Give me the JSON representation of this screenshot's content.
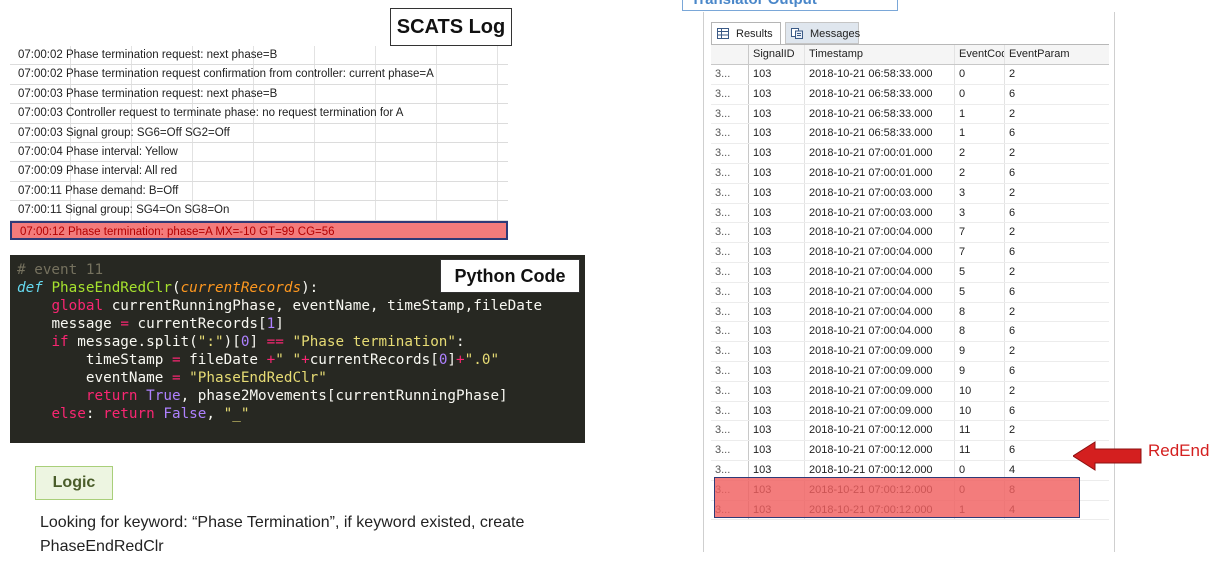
{
  "scats": {
    "title": "SCATS Log",
    "rows": [
      "07:00:02 Phase termination request: next phase=B",
      "07:00:02 Phase termination request confirmation from controller: current phase=A",
      "07:00:03 Phase termination request: next phase=B",
      "07:00:03 Controller request to terminate phase: no request termination for A",
      "07:00:03 Signal group: SG6=Off SG2=Off",
      "07:00:04 Phase interval: Yellow",
      "07:00:09 Phase interval: All red",
      "07:00:11 Phase demand: B=Off",
      "07:00:11 Signal group: SG4=On SG8=On",
      "07:00:12 Phase termination: phase=A MX=-10 GT=99 CG=56"
    ]
  },
  "python": {
    "title": "Python Code",
    "comment": "# event 11",
    "def_kw": "def",
    "func_name": "PhaseEndRedClr",
    "param": "currentRecords",
    "global_kw": "global",
    "global_vars": " currentRunningPhase, eventName, timeStamp,fileDate",
    "message_assign": "message ",
    "message_rhs": " currentRecords[",
    "idx1": "1",
    "if_kw": "if",
    "split_a": " message.split(",
    "colon_str": "\":\"",
    "split_b": ")[",
    "idx0": "0",
    "split_c": "] ",
    "phase_str": "\"Phase termination\"",
    "ts_a": "timeStamp ",
    "ts_b": " fileDate ",
    "space_str": "\" \"",
    "ts_c": "currentRecords[",
    "ts_d": "]",
    "dot0_str": "\".0\"",
    "ev_a": "eventName ",
    "ev_str": "\"PhaseEndRedClr\"",
    "return_kw": "return",
    "true_kw": "True",
    "return_rest": ", phase2Movements[currentRunningPhase]",
    "else_kw": "else",
    "false_kw": "False",
    "underscore_str": "\"_\""
  },
  "logic": {
    "title": "Logic",
    "text": "Looking for keyword: “Phase Termination”, if keyword existed, create PhaseEndRedClr"
  },
  "translator": {
    "title": "Translator Output"
  },
  "results": {
    "tabs": [
      "Results",
      "Messages"
    ],
    "columns": [
      "",
      "SignalID",
      "Timestamp",
      "EventCode",
      "EventParam"
    ],
    "rows": [
      [
        "3...",
        "103",
        "2018-10-21 06:58:33.000",
        "0",
        "2"
      ],
      [
        "3...",
        "103",
        "2018-10-21 06:58:33.000",
        "0",
        "6"
      ],
      [
        "3...",
        "103",
        "2018-10-21 06:58:33.000",
        "1",
        "2"
      ],
      [
        "3...",
        "103",
        "2018-10-21 06:58:33.000",
        "1",
        "6"
      ],
      [
        "3...",
        "103",
        "2018-10-21 07:00:01.000",
        "2",
        "2"
      ],
      [
        "3...",
        "103",
        "2018-10-21 07:00:01.000",
        "2",
        "6"
      ],
      [
        "3...",
        "103",
        "2018-10-21 07:00:03.000",
        "3",
        "2"
      ],
      [
        "3...",
        "103",
        "2018-10-21 07:00:03.000",
        "3",
        "6"
      ],
      [
        "3...",
        "103",
        "2018-10-21 07:00:04.000",
        "7",
        "2"
      ],
      [
        "3...",
        "103",
        "2018-10-21 07:00:04.000",
        "7",
        "6"
      ],
      [
        "3...",
        "103",
        "2018-10-21 07:00:04.000",
        "5",
        "2"
      ],
      [
        "3...",
        "103",
        "2018-10-21 07:00:04.000",
        "5",
        "6"
      ],
      [
        "3...",
        "103",
        "2018-10-21 07:00:04.000",
        "8",
        "2"
      ],
      [
        "3...",
        "103",
        "2018-10-21 07:00:04.000",
        "8",
        "6"
      ],
      [
        "3...",
        "103",
        "2018-10-21 07:00:09.000",
        "9",
        "2"
      ],
      [
        "3...",
        "103",
        "2018-10-21 07:00:09.000",
        "9",
        "6"
      ],
      [
        "3...",
        "103",
        "2018-10-21 07:00:09.000",
        "10",
        "2"
      ],
      [
        "3...",
        "103",
        "2018-10-21 07:00:09.000",
        "10",
        "6"
      ],
      [
        "3...",
        "103",
        "2018-10-21 07:00:12.000",
        "11",
        "2"
      ],
      [
        "3...",
        "103",
        "2018-10-21 07:00:12.000",
        "11",
        "6"
      ],
      [
        "3...",
        "103",
        "2018-10-21 07:00:12.000",
        "0",
        "4"
      ],
      [
        "3...",
        "103",
        "2018-10-21 07:00:12.000",
        "0",
        "8"
      ],
      [
        "3...",
        "103",
        "2018-10-21 07:00:12.000",
        "1",
        "4"
      ]
    ]
  },
  "annotation": {
    "label": "RedEnd",
    "arrow_icon": "left-arrow-icon",
    "color": "#d41f1f"
  },
  "colors": {
    "highlight": "#f47b7b",
    "code_bg": "#272822",
    "translator_title": "#4a87c9"
  }
}
